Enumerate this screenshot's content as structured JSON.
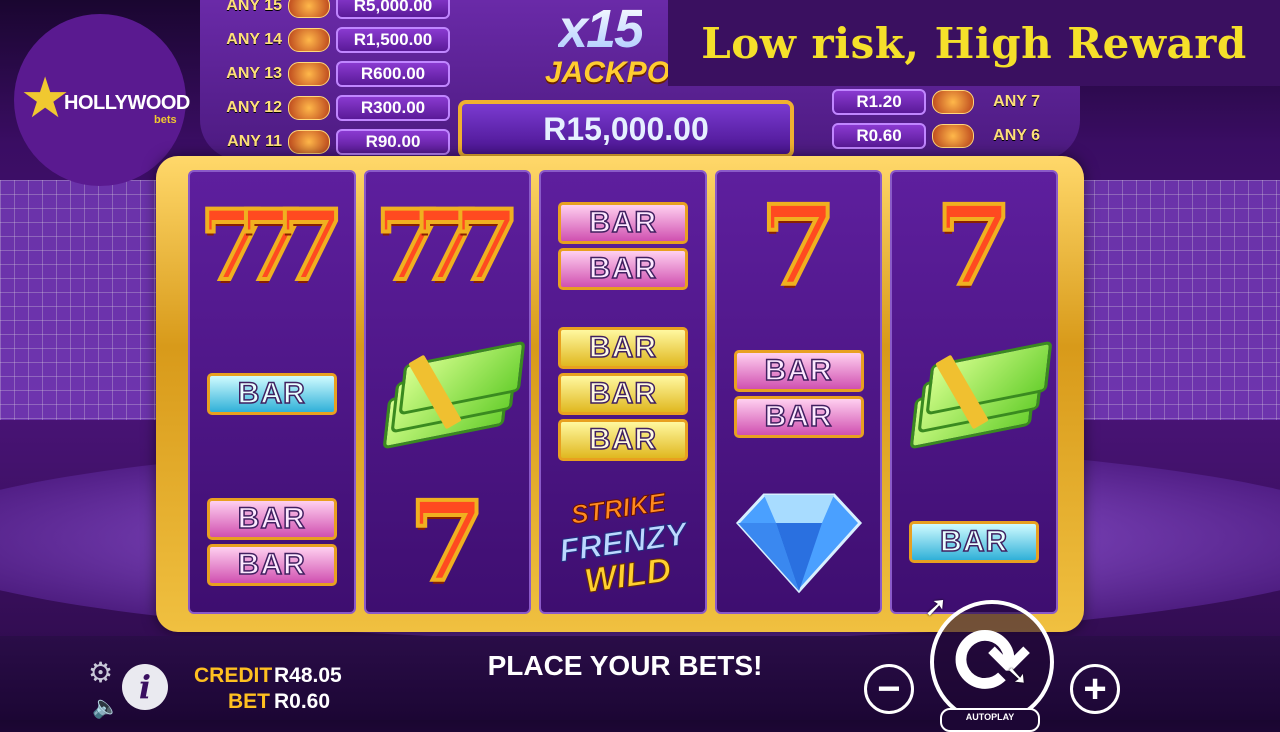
{
  "banner": {
    "text": "Low risk, High Reward"
  },
  "logo": {
    "name": "HOLLYWOOD",
    "sub": "bets"
  },
  "jackpot": {
    "multiplier": "x15",
    "label": "JACKPOT",
    "amount": "R15,000.00"
  },
  "paytable_left": [
    {
      "any": "ANY 15",
      "value": "R5,000.00"
    },
    {
      "any": "ANY 14",
      "value": "R1,500.00"
    },
    {
      "any": "ANY 13",
      "value": "R600.00"
    },
    {
      "any": "ANY 12",
      "value": "R300.00"
    },
    {
      "any": "ANY 11",
      "value": "R90.00"
    }
  ],
  "paytable_right": [
    {
      "any": "ANY 7",
      "value": "R1.20"
    },
    {
      "any": "ANY 6",
      "value": "R0.60"
    }
  ],
  "reels": [
    [
      "triple-seven",
      "bar-1-cyan",
      "bar-2-pink"
    ],
    [
      "triple-seven",
      "cash",
      "seven"
    ],
    [
      "bar-2-pink",
      "bar-3-yellow",
      "wild"
    ],
    [
      "seven",
      "bar-2-pink",
      "diamond"
    ],
    [
      "seven",
      "cash",
      "bar-1-cyan"
    ]
  ],
  "symbol_text": {
    "bar": "BAR",
    "seven": "7",
    "wild_1": "STRIKE",
    "wild_2": "FRENZY",
    "wild_3": "WILD"
  },
  "footer": {
    "credit_label": "CREDIT",
    "credit_value": "R48.05",
    "bet_label": "BET",
    "bet_value": "R0.60",
    "status": "PLACE YOUR BETS!",
    "minus": "−",
    "plus": "+",
    "info": "i",
    "autoplay": "AUTOPLAY"
  },
  "icons": {
    "settings": "gear-icon",
    "sound": "speaker-icon",
    "spin": "spin-arrows-icon"
  }
}
